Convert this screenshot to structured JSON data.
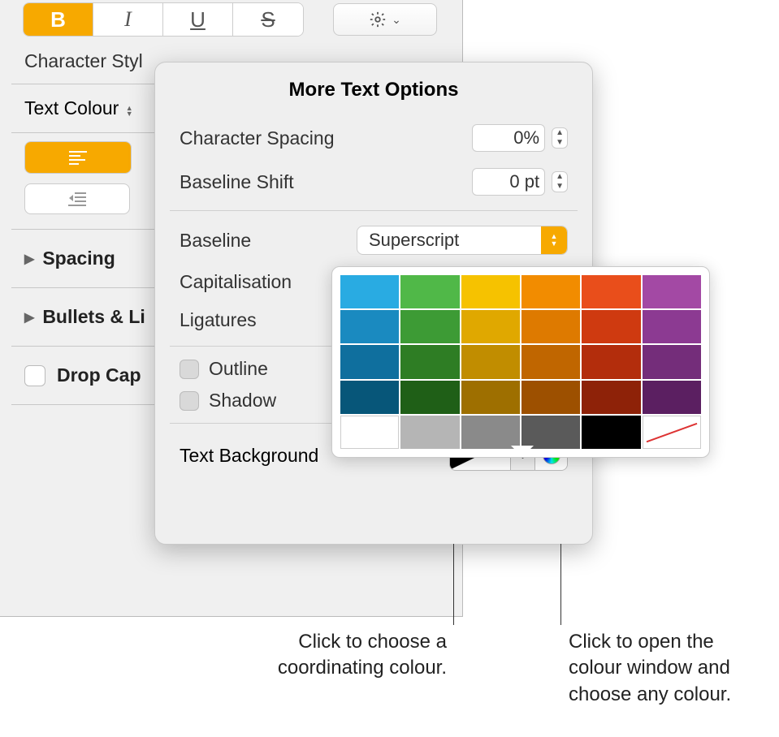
{
  "sidebar": {
    "character_styles_label": "Character Styl",
    "text_colour_label": "Text Colour",
    "spacing_label": "Spacing",
    "bullets_label": "Bullets & Li",
    "dropcap_label": "Drop Cap"
  },
  "popover": {
    "title": "More Text Options",
    "char_spacing_label": "Character Spacing",
    "char_spacing_value": "0%",
    "baseline_shift_label": "Baseline Shift",
    "baseline_shift_value": "0 pt",
    "baseline_label": "Baseline",
    "baseline_value": "Superscript",
    "capitalisation_label": "Capitalisation",
    "ligatures_label": "Ligatures",
    "outline_label": "Outline",
    "shadow_label": "Shadow",
    "text_background_label": "Text Background"
  },
  "swatches": {
    "rows": [
      [
        "#29abe2",
        "#50b848",
        "#f6c200",
        "#f28c00",
        "#e94e1b",
        "#a349a4"
      ],
      [
        "#1a8ac0",
        "#3d9b35",
        "#e0a800",
        "#de7a00",
        "#cf3a10",
        "#8c3a92"
      ],
      [
        "#0f6f9e",
        "#2e7d24",
        "#c18d00",
        "#c06600",
        "#b32d0c",
        "#742d7a"
      ],
      [
        "#075679",
        "#1f5f17",
        "#9e6f00",
        "#9d5000",
        "#8e2208",
        "#5b1f61"
      ]
    ],
    "grays": [
      "#ffffff",
      "#b5b5b5",
      "#8a8a8a",
      "#5a5a5a",
      "#000000"
    ]
  },
  "callouts": {
    "left_line1": "Click to choose a",
    "left_line2": "coordinating colour.",
    "right_line1": "Click to open the",
    "right_line2": "colour window and",
    "right_line3": "choose any colour."
  }
}
